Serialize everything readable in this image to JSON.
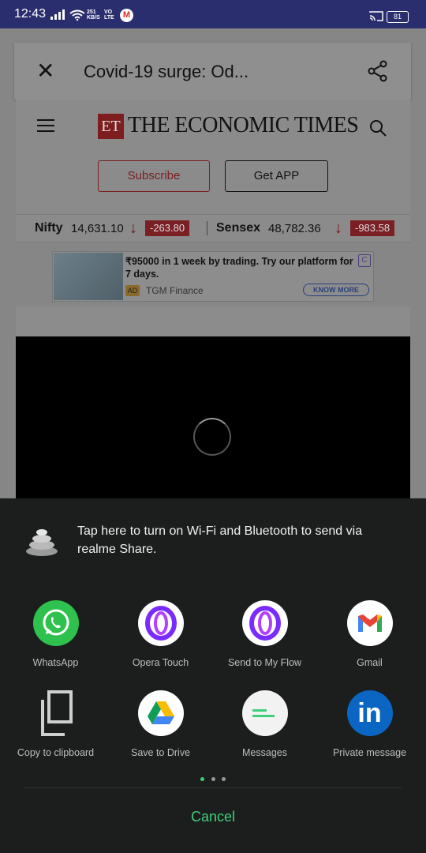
{
  "status_bar": {
    "time": "12:43",
    "net_speed_top": "251",
    "net_speed_bottom": "KB/S",
    "volte_top": "VO",
    "volte_bottom": "LTE",
    "gmail_glyph": "M",
    "battery": "81"
  },
  "browser_bar": {
    "close_glyph": "✕",
    "title": "Covid-19 surge: Od..."
  },
  "site_header": {
    "logo_mark": "ET",
    "logo_text": "THE ECONOMIC TIMES"
  },
  "header_buttons": {
    "subscribe": "Subscribe",
    "get_app": "Get APP"
  },
  "ticker": {
    "nifty_name": "Nifty",
    "nifty_value": "14,631.10",
    "nifty_change": "-263.80",
    "sensex_name": "Sensex",
    "sensex_value": "48,782.36",
    "sensex_change": "-983.58",
    "arrow": "↓"
  },
  "ad": {
    "text": "₹95000 in 1 week by trading. Try our platform for 7 days.",
    "tag": "AD",
    "brand": "TGM Finance",
    "cta": "KNOW MORE",
    "choice_glyph": "C"
  },
  "share_sheet": {
    "realme_message": "Tap here to turn on Wi-Fi and Bluetooth to send via realme Share.",
    "apps_row1": [
      {
        "label": "WhatsApp",
        "icon": "whatsapp-icon"
      },
      {
        "label": "Opera Touch",
        "icon": "opera-icon"
      },
      {
        "label": "Send to My Flow",
        "icon": "opera-icon"
      },
      {
        "label": "Gmail",
        "icon": "gmail-icon"
      }
    ],
    "apps_row2": [
      {
        "label": "Copy to clipboard",
        "icon": "copy-icon"
      },
      {
        "label": "Save to Drive",
        "icon": "drive-icon"
      },
      {
        "label": "Messages",
        "icon": "messages-icon"
      },
      {
        "label": "Private message",
        "icon": "linkedin-icon"
      }
    ],
    "linkedin_glyph": "in",
    "cancel": "Cancel",
    "page_indicator_active": 1,
    "page_indicator_count": 3,
    "accent_color": "#3fcf7a"
  }
}
